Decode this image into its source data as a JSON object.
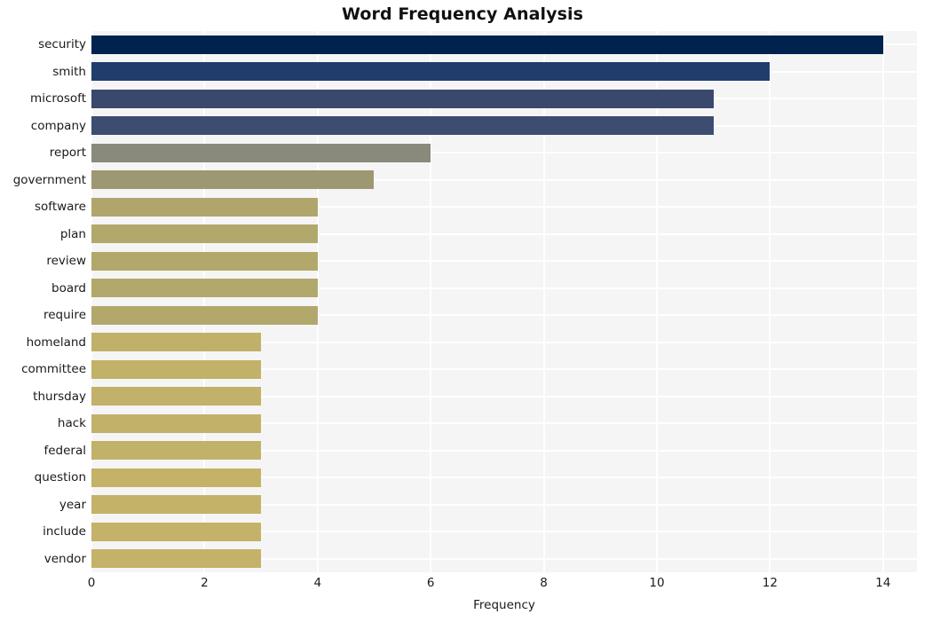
{
  "chart_data": {
    "type": "bar",
    "orientation": "horizontal",
    "title": "Word Frequency Analysis",
    "xlabel": "Frequency",
    "ylabel": "",
    "xlim": [
      0,
      14.6
    ],
    "xticks": [
      0,
      2,
      4,
      6,
      8,
      10,
      12,
      14
    ],
    "xtick_labels": [
      "0",
      "2",
      "4",
      "6",
      "8",
      "10",
      "12",
      "14"
    ],
    "grid": true,
    "grid_color": "#ffffff",
    "plot_background": "#f5f5f6",
    "figure_background": "#ffffff",
    "legend": null,
    "colormap": "cividis",
    "categories": [
      "security",
      "smith",
      "microsoft",
      "company",
      "report",
      "government",
      "software",
      "plan",
      "review",
      "board",
      "require",
      "homeland",
      "committee",
      "thursday",
      "hack",
      "federal",
      "question",
      "year",
      "include",
      "vendor"
    ],
    "values": [
      14,
      12,
      11,
      11,
      6,
      5,
      4,
      4,
      4,
      4,
      4,
      3,
      3,
      3,
      3,
      3,
      3,
      3,
      3,
      3
    ],
    "bar_colors": [
      "#00224e",
      "#213d6b",
      "#3a486e",
      "#3c4d71",
      "#898a7c",
      "#9d9772",
      "#b0a66c",
      "#b2a86b",
      "#b2a86b",
      "#b2a86b",
      "#b2a86b",
      "#c0b069",
      "#c1b169",
      "#c1b169",
      "#c2b168",
      "#c2b168",
      "#c3b268",
      "#c3b268",
      "#c3b268",
      "#c3b268"
    ]
  }
}
